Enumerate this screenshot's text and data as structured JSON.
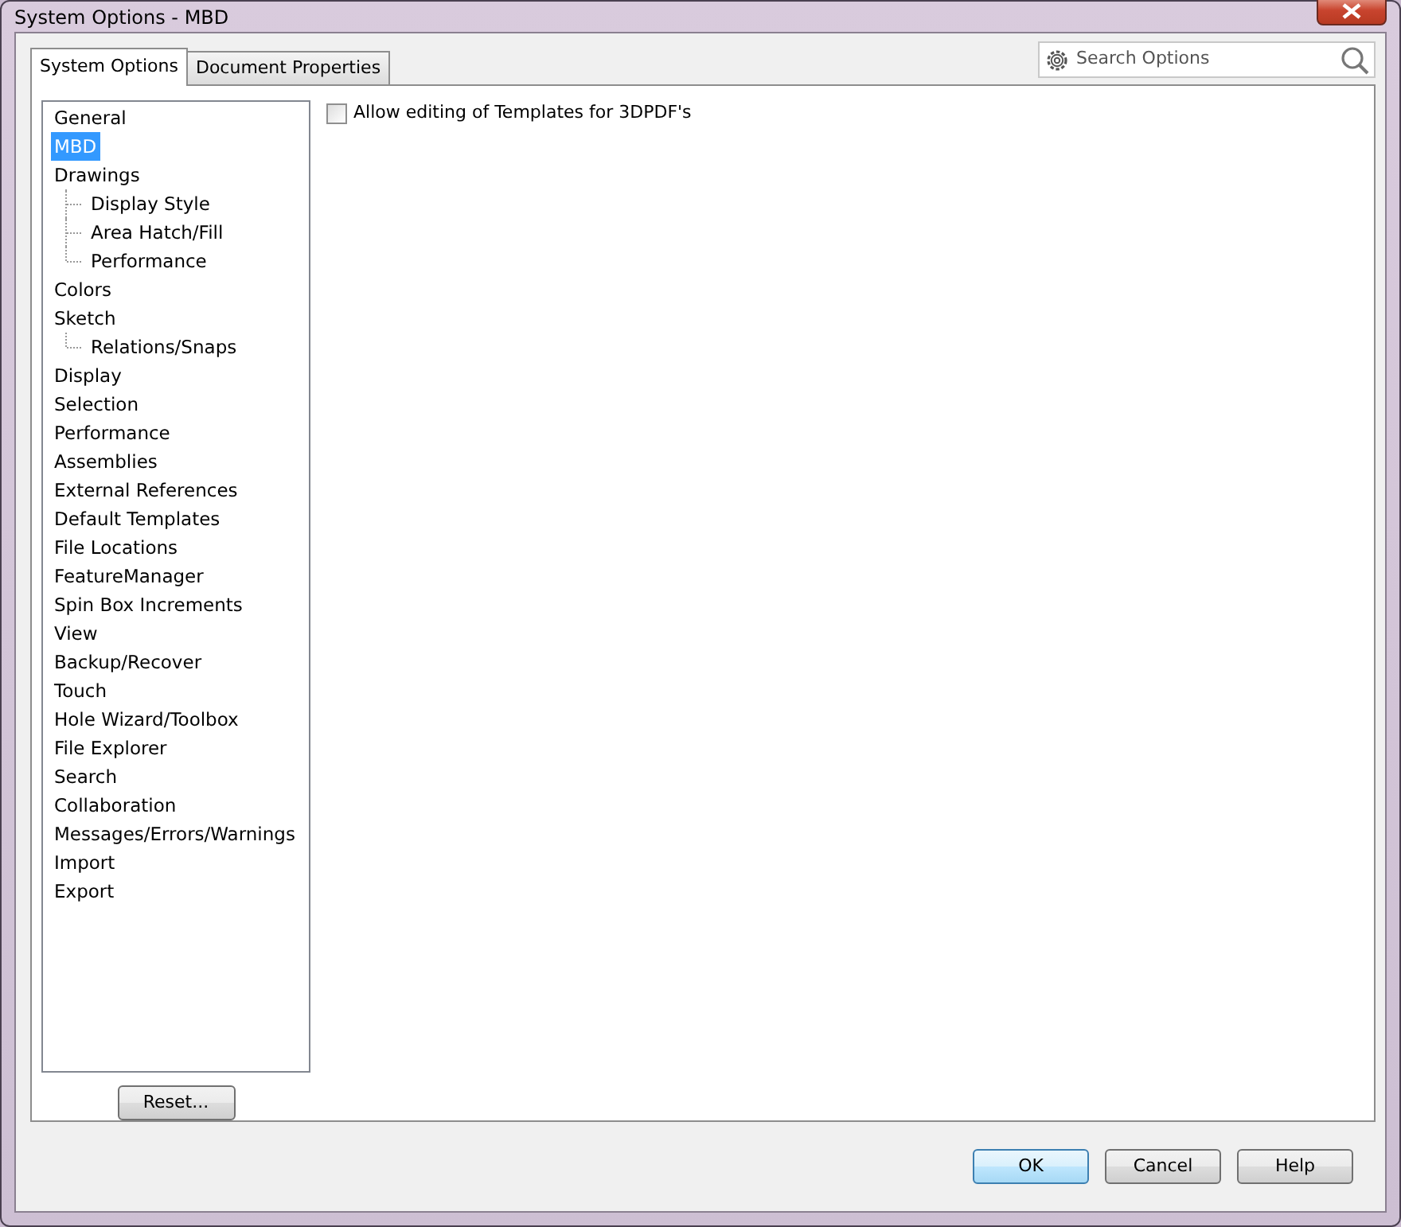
{
  "window": {
    "title": "System Options - MBD"
  },
  "tabs": [
    {
      "label": "System Options",
      "selected": true
    },
    {
      "label": "Document Properties",
      "selected": false
    }
  ],
  "search": {
    "placeholder": "Search Options"
  },
  "tree": [
    {
      "label": "General",
      "selected": false
    },
    {
      "label": "MBD",
      "selected": true
    },
    {
      "label": "Drawings",
      "selected": false,
      "children": [
        {
          "label": "Display Style",
          "selected": false
        },
        {
          "label": "Area Hatch/Fill",
          "selected": false
        },
        {
          "label": "Performance",
          "selected": false
        }
      ]
    },
    {
      "label": "Colors",
      "selected": false
    },
    {
      "label": "Sketch",
      "selected": false,
      "children": [
        {
          "label": "Relations/Snaps",
          "selected": false
        }
      ]
    },
    {
      "label": "Display",
      "selected": false
    },
    {
      "label": "Selection",
      "selected": false
    },
    {
      "label": "Performance",
      "selected": false
    },
    {
      "label": "Assemblies",
      "selected": false
    },
    {
      "label": "External References",
      "selected": false
    },
    {
      "label": "Default Templates",
      "selected": false
    },
    {
      "label": "File Locations",
      "selected": false
    },
    {
      "label": "FeatureManager",
      "selected": false
    },
    {
      "label": "Spin Box Increments",
      "selected": false
    },
    {
      "label": "View",
      "selected": false
    },
    {
      "label": "Backup/Recover",
      "selected": false
    },
    {
      "label": "Touch",
      "selected": false
    },
    {
      "label": "Hole Wizard/Toolbox",
      "selected": false
    },
    {
      "label": "File Explorer",
      "selected": false
    },
    {
      "label": "Search",
      "selected": false
    },
    {
      "label": "Collaboration",
      "selected": false
    },
    {
      "label": "Messages/Errors/Warnings",
      "selected": false
    },
    {
      "label": "Import",
      "selected": false
    },
    {
      "label": "Export",
      "selected": false
    }
  ],
  "options": [
    {
      "label": "Allow editing of Templates for 3DPDF's",
      "checked": false
    }
  ],
  "reset_button": "Reset...",
  "buttons": [
    {
      "label": "OK",
      "default": true
    },
    {
      "label": "Cancel",
      "default": false
    },
    {
      "label": "Help",
      "default": false
    }
  ]
}
